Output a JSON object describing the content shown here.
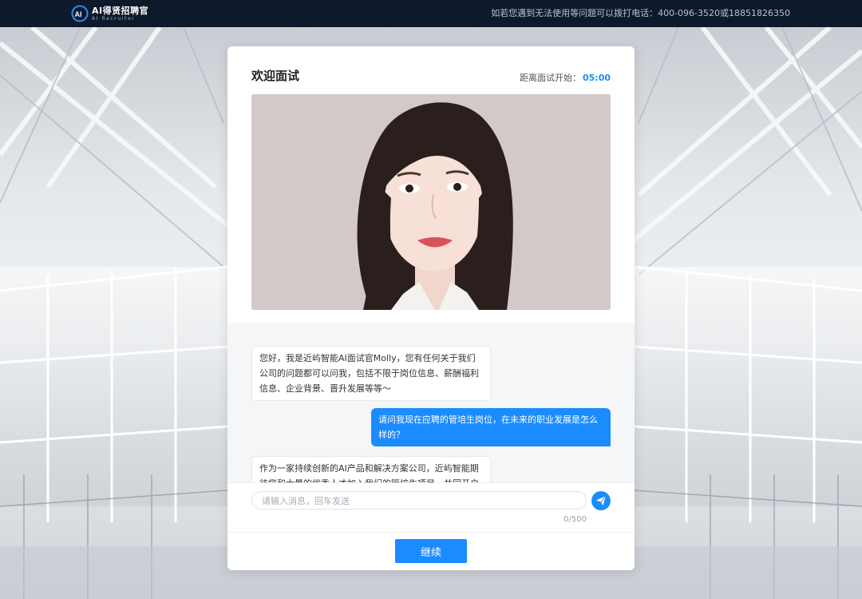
{
  "header": {
    "logo_title": "AI得贤招聘官",
    "logo_subtitle": "AI Recruiter",
    "hotline": "如若您遇到无法使用等问题可以拨打电话：400-096-3520或18851826350"
  },
  "interview": {
    "title": "欢迎面试",
    "countdown_label": "距离面试开始：",
    "countdown_time": "05:00"
  },
  "chat": {
    "messages": [
      {
        "role": "bot",
        "text": "您好，我是近屿智能AI面试官Molly，您有任何关于我们公司的问题都可以问我，包括不限于岗位信息、薪酬福利信息、企业背景、晋升发展等等～"
      },
      {
        "role": "user",
        "text": "请问我现在应聘的管培生岗位，在未来的职业发展是怎么样的？"
      },
      {
        "role": "bot",
        "text": "作为一家持续创新的AI产品和解决方案公司，近屿智能期待您和大量的优秀人才加入我们的管培生项目，共同开启成功"
      }
    ],
    "input_placeholder": "请输入消息，回车发送",
    "input_value": "",
    "char_count": "0/500"
  },
  "actions": {
    "continue_label": "继续"
  },
  "colors": {
    "accent": "#1a8cff",
    "topbar": "#0e1a2b"
  },
  "icons": {
    "send": "paper-plane-icon",
    "logo": "ai-logo-icon"
  }
}
